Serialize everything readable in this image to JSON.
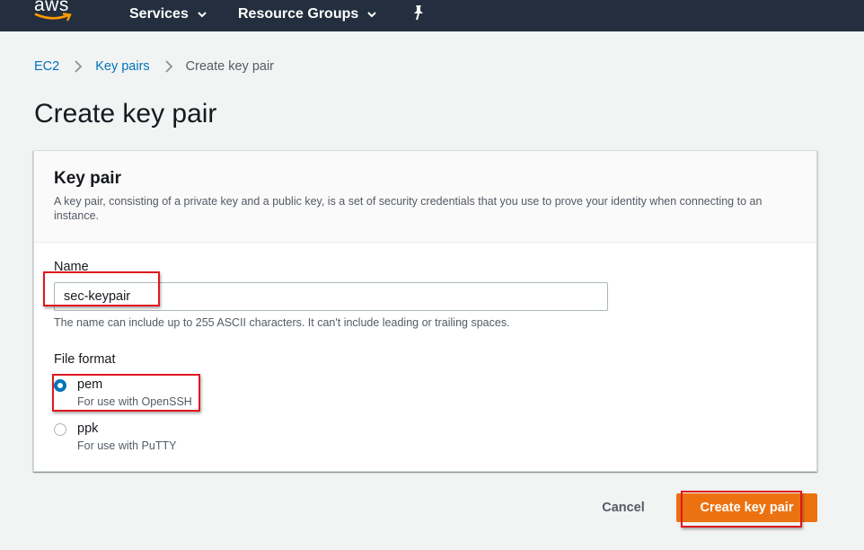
{
  "topnav": {
    "logo_text": "aws",
    "services_label": "Services",
    "resource_groups_label": "Resource Groups",
    "pin_icon": "pin-icon"
  },
  "breadcrumb": {
    "items": [
      "EC2",
      "Key pairs"
    ],
    "current": "Create key pair"
  },
  "page_title": "Create key pair",
  "panel": {
    "title": "Key pair",
    "description": "A key pair, consisting of a private key and a public key, is a set of security credentials that you use to prove your identity when connecting to an instance.",
    "name_label": "Name",
    "name_value": "sec-keypair",
    "name_hint": "The name can include up to 255 ASCII characters. It can't include leading or trailing spaces.",
    "format_label": "File format",
    "formats": [
      {
        "label": "pem",
        "sub": "For use with OpenSSH",
        "checked": true
      },
      {
        "label": "ppk",
        "sub": "For use with PuTTY",
        "checked": false
      }
    ]
  },
  "footer": {
    "cancel_label": "Cancel",
    "create_label": "Create key pair"
  },
  "colors": {
    "nav_bg": "#232f3e",
    "link": "#0073bb",
    "primary": "#ec7211",
    "highlight": "#e0181e"
  }
}
